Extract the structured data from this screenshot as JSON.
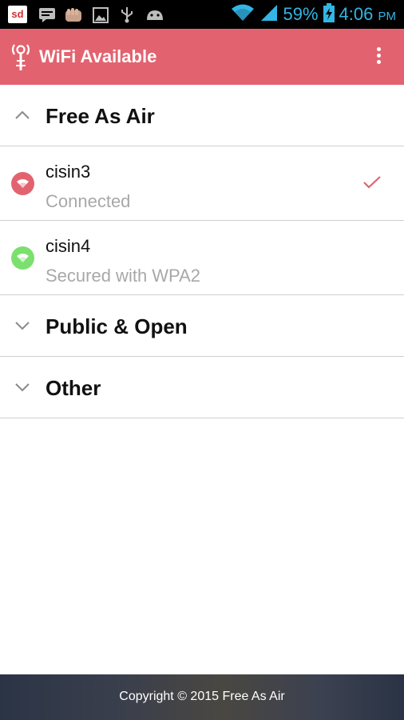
{
  "status_bar": {
    "notification_icons": [
      "sd-app-icon",
      "chat-icon",
      "fist-app-icon",
      "image-icon",
      "usb-icon",
      "android-icon"
    ],
    "wifi_icon": "wifi-signal-icon",
    "cell_icon": "cell-signal-icon",
    "battery_percent": "59%",
    "battery_icon": "battery-charging-icon",
    "time": "4:06",
    "ampm": "PM",
    "accent_color": "#33b5e5"
  },
  "app_bar": {
    "title": "WiFi Available",
    "logo_icon": "tower-antenna-icon",
    "menu_icon": "overflow-menu-icon",
    "color": "#e2636f"
  },
  "groups": [
    {
      "label": "Free As Air",
      "expanded": true,
      "networks": [
        {
          "name": "cisin3",
          "status": "Connected",
          "icon_color": "#e2636f",
          "connected": true
        },
        {
          "name": "cisin4",
          "status": "Secured with WPA2",
          "icon_color": "#7be06e",
          "connected": false
        }
      ]
    },
    {
      "label": "Public & Open",
      "expanded": false
    },
    {
      "label": "Other",
      "expanded": false
    }
  ],
  "footer": {
    "text": "Copyright © 2015 Free As Air"
  }
}
